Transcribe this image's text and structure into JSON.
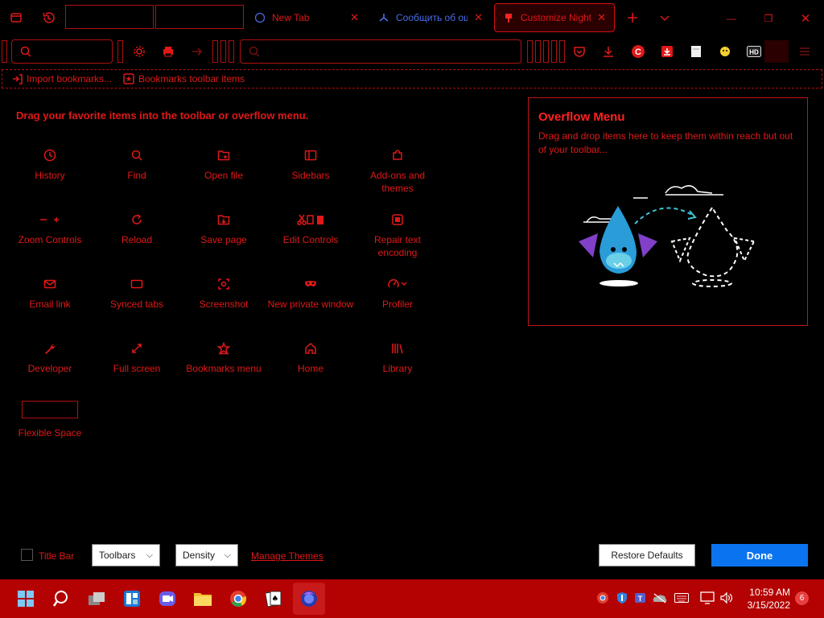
{
  "tabs": [
    {
      "label": "New Tab",
      "close": "✕"
    },
    {
      "label": "Сообщить об ош",
      "close": "✕"
    },
    {
      "label": "Customize Nightly",
      "close": "✕"
    }
  ],
  "window_controls": {
    "minimize": "—",
    "maximize": "❐",
    "close": "✕"
  },
  "bookmarks": {
    "import": "Import bookmarks...",
    "toolbar_items": "Bookmarks toolbar items"
  },
  "palette": {
    "heading": "Drag your favorite items into the toolbar or overflow menu.",
    "items": [
      {
        "label": "History",
        "icon": "clock-icon"
      },
      {
        "label": "Find",
        "icon": "search-icon"
      },
      {
        "label": "Open file",
        "icon": "folder-icon"
      },
      {
        "label": "Sidebars",
        "icon": "sidebar-icon"
      },
      {
        "label": "Add-ons and themes",
        "icon": "puzzle-icon"
      },
      {
        "label": "Zoom Controls",
        "icon": "zoom-icon"
      },
      {
        "label": "Reload",
        "icon": "reload-icon"
      },
      {
        "label": "Save page",
        "icon": "save-icon"
      },
      {
        "label": "Edit Controls",
        "icon": "edit-icon"
      },
      {
        "label": "Repair text encoding",
        "icon": "encoding-icon"
      },
      {
        "label": "Email link",
        "icon": "mail-icon"
      },
      {
        "label": "Synced tabs",
        "icon": "synced-tabs-icon"
      },
      {
        "label": "Screenshot",
        "icon": "screenshot-icon"
      },
      {
        "label": "New private window",
        "icon": "mask-icon"
      },
      {
        "label": "Profiler",
        "icon": "profiler-icon"
      },
      {
        "label": "Developer",
        "icon": "wrench-icon"
      },
      {
        "label": "Full screen",
        "icon": "fullscreen-icon"
      },
      {
        "label": "Bookmarks menu",
        "icon": "star-icon"
      },
      {
        "label": "Home",
        "icon": "home-icon"
      },
      {
        "label": "Library",
        "icon": "library-icon"
      },
      {
        "label": "Flexible Space",
        "icon": "flexible-space-icon"
      }
    ]
  },
  "overflow": {
    "title": "Overflow Menu",
    "description": "Drag and drop items here to keep them within reach but out of your toolbar..."
  },
  "footer": {
    "title_bar": "Title Bar",
    "toolbars": "Toolbars",
    "density": "Density",
    "manage_themes": "Manage Themes",
    "restore_defaults": "Restore Defaults",
    "done": "Done"
  },
  "taskbar": {
    "time": "10:59 AM",
    "date": "3/15/2022",
    "notifications": "6"
  },
  "colors": {
    "accent": "#e01818",
    "done": "#0a74f0",
    "taskbar": "#b40202"
  }
}
